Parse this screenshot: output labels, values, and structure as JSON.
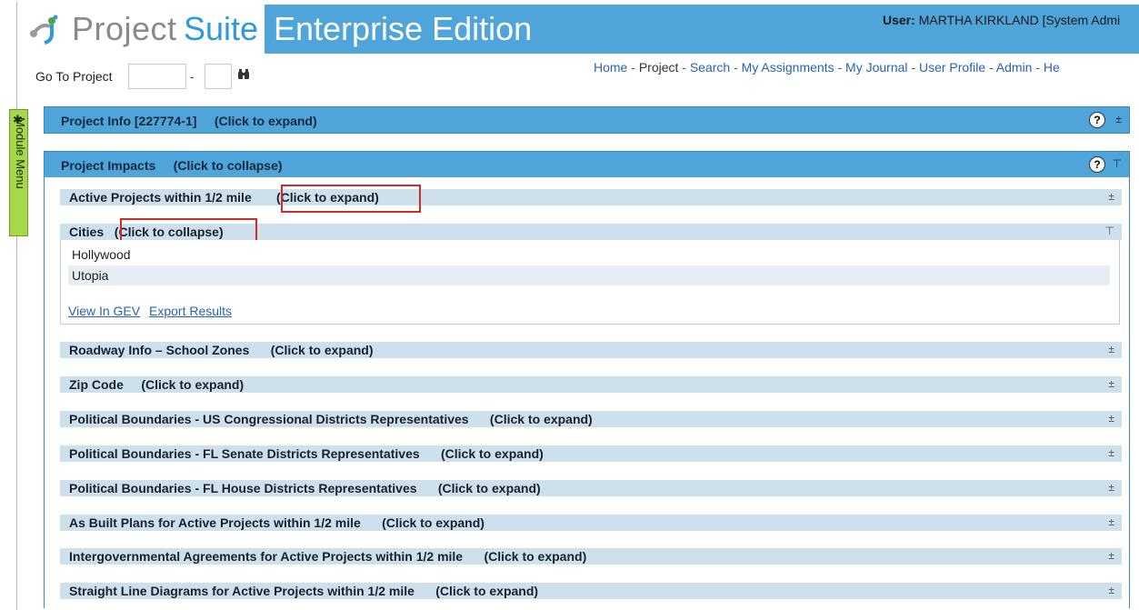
{
  "header": {
    "logo_part1": "Project",
    "logo_part2": "Suite",
    "logo_part3": "Enterprise Edition",
    "user_prefix": "User:",
    "user_name": "MARTHA KIRKLAND [System Admi"
  },
  "goto": {
    "label": "Go To Project",
    "separator": "-"
  },
  "nav": {
    "items": [
      "Home",
      "Project",
      "Search",
      "My Assignments",
      "My Journal",
      "User Profile",
      "Admin",
      "He"
    ],
    "separator": " - "
  },
  "module_menu": {
    "label": "Module Menu"
  },
  "sections": {
    "project_info": {
      "title": "Project Info [227774-1]",
      "action": "(Click to expand)"
    },
    "project_impacts": {
      "title": "Project Impacts",
      "action": "(Click to collapse)"
    }
  },
  "impacts": [
    {
      "title": "Active Projects within 1/2 mile",
      "action": "(Click to expand)"
    },
    {
      "title": "Cities",
      "action": "(Click to collapse)"
    },
    {
      "title": "Roadway Info – School Zones",
      "action": "(Click to expand)"
    },
    {
      "title": "Zip Code",
      "action": "(Click to expand)"
    },
    {
      "title": "Political Boundaries - US Congressional Districts Representatives",
      "action": "(Click to expand)"
    },
    {
      "title": "Political Boundaries - FL Senate Districts Representatives",
      "action": "(Click to expand)"
    },
    {
      "title": "Political Boundaries - FL House Districts Representatives",
      "action": "(Click to expand)"
    },
    {
      "title": "As Built Plans for Active Projects within 1/2 mile",
      "action": "(Click to expand)"
    },
    {
      "title": "Intergovernmental Agreements for Active Projects within 1/2 mile",
      "action": "(Click to expand)"
    },
    {
      "title": "Straight Line Diagrams for Active Projects within 1/2 mile",
      "action": "(Click to expand)"
    }
  ],
  "cities": {
    "rows": [
      "Hollywood",
      "Utopia"
    ],
    "link_view": "View In GEV",
    "link_export": "Export Results"
  },
  "icons": {
    "help": "?",
    "expand": "±",
    "collapse": "⊤",
    "binoculars": "binoculars-icon"
  },
  "colors": {
    "header_bg": "#4fa4d9",
    "subheader_bg": "#cde0ec",
    "highlight_box": "#d02a2a",
    "module_menu_bg": "#a6d84c"
  }
}
